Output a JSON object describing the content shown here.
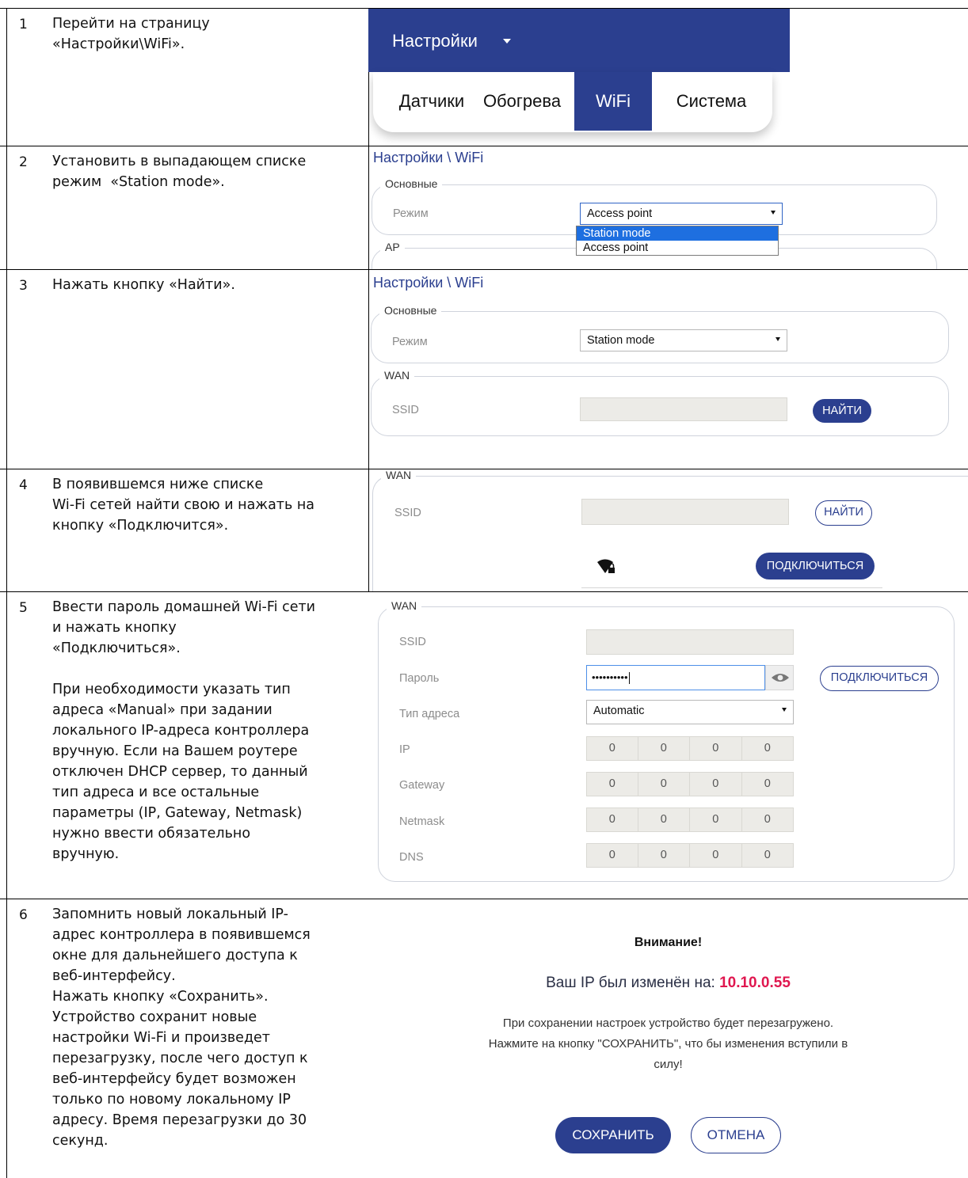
{
  "steps": [
    {
      "num": "1",
      "text": [
        "Перейти на страницу",
        "«Настройки\\WiFi»."
      ]
    },
    {
      "num": "2",
      "text": [
        "Установить в выпадающем списке",
        "режим  «Station mode»."
      ]
    },
    {
      "num": "3",
      "text": [
        "Нажать кнопку «Найти»."
      ]
    },
    {
      "num": "4",
      "text": [
        "В появившемся ниже списке",
        "Wi-Fi сетей найти свою и нажать на",
        "кнопку «Подключится»."
      ]
    },
    {
      "num": "5",
      "text": [
        "Ввести пароль домашней Wi-Fi сети",
        "и нажать кнопку",
        "«Подключиться».",
        "",
        "При необходимости указать тип",
        "адреса «Manual» при задании",
        "локального IP-адреса контроллера",
        "вручную. Если на Вашем роутере",
        "отключен DHCP сервер, то данный",
        "тип адреса и все остальные",
        "параметры (IP, Gateway, Netmask)",
        "нужно ввести обязательно",
        "вручную."
      ]
    },
    {
      "num": "6",
      "text": [
        "Запомнить новый локальный IP-",
        "адрес контроллера в появившемся",
        "окне для дальнейшего доступа к",
        "веб-интерфейсу.",
        "Нажать кнопку «Сохранить».",
        "Устройство сохранит новые",
        "настройки Wi-Fi и произведет",
        "перезагрузку, после чего доступ к",
        "веб-интерфейсу будет возможен",
        "только по новому локальному IP",
        "адресу. Время перезагрузки до 30",
        "секунд."
      ]
    }
  ],
  "nav": {
    "title": "Настройки",
    "menu": [
      "Датчики",
      "Обогрева",
      "WiFi",
      "Система"
    ],
    "active": "WiFi"
  },
  "breadcrumb": "Настройки \\ WiFi",
  "labels": {
    "basic": "Основные",
    "mode": "Режим",
    "ap": "AP",
    "wan": "WAN",
    "ssid": "SSID",
    "password": "Пароль",
    "addr_type": "Тип адреса",
    "ip": "IP",
    "gateway": "Gateway",
    "netmask": "Netmask",
    "dns": "DNS"
  },
  "mode_select": {
    "value_before": "Access point",
    "options": [
      "Station mode",
      "Access point"
    ],
    "highlighted": "Station mode",
    "value_after": "Station mode"
  },
  "buttons": {
    "find": "НАЙТИ",
    "connect": "ПОДКЛЮЧИТЬСЯ",
    "save": "СОХРАНИТЬ",
    "cancel": "ОТМЕНА"
  },
  "wan_form": {
    "password_mask": "••••••••••",
    "addr_type_value": "Automatic",
    "ip": [
      "0",
      "0",
      "0",
      "0"
    ],
    "gateway": [
      "0",
      "0",
      "0",
      "0"
    ],
    "netmask": [
      "0",
      "0",
      "0",
      "0"
    ],
    "dns": [
      "0",
      "0",
      "0",
      "0"
    ]
  },
  "dialog": {
    "title": "Внимание!",
    "ip_prefix": "Ваш IP был изменён на: ",
    "ip_value": "10.10.0.55",
    "note": [
      "При сохранении настроек устройство будет перезагружено.",
      "Нажмите на кнопку \"СОХРАНИТЬ\", что бы изменения вступили в",
      "силу!"
    ]
  },
  "icons": {
    "wifi_locked": "wifi-lock-icon",
    "show_password": "eye-icon",
    "dropdown_caret": "caret-down-icon"
  },
  "colors": {
    "brand": "#2b3f8f",
    "ip_highlight": "#e0174f",
    "selection": "#1e6fe0"
  }
}
